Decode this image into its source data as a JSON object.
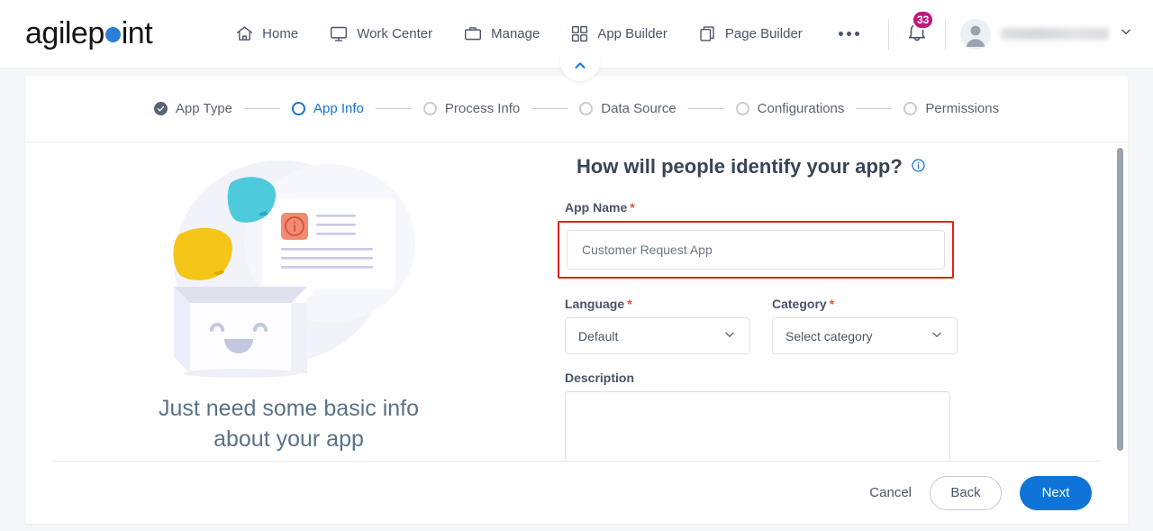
{
  "brand": {
    "name_part1": "agilep",
    "name_part2": "int",
    "dot_color": "#2a7fd4"
  },
  "topnav": {
    "items": [
      {
        "label": "Home",
        "icon": "home-icon"
      },
      {
        "label": "Work Center",
        "icon": "monitor-icon"
      },
      {
        "label": "Manage",
        "icon": "briefcase-icon"
      },
      {
        "label": "App Builder",
        "icon": "grid-icon"
      },
      {
        "label": "Page Builder",
        "icon": "copy-icon"
      }
    ],
    "more_label": "",
    "notifications": {
      "count": "33",
      "icon": "bell-icon",
      "badge_color": "#c2187e"
    },
    "user": {
      "name": "",
      "avatar_icon": "user-avatar-icon",
      "chevron_icon": "chevron-down-icon"
    }
  },
  "collapse": {
    "icon": "chevron-up-icon"
  },
  "stepper": {
    "steps": [
      {
        "label": "App Type",
        "state": "done"
      },
      {
        "label": "App Info",
        "state": "active"
      },
      {
        "label": "Process Info",
        "state": "todo"
      },
      {
        "label": "Data Source",
        "state": "todo"
      },
      {
        "label": "Configurations",
        "state": "todo"
      },
      {
        "label": "Permissions",
        "state": "todo"
      }
    ]
  },
  "illustration": {
    "caption": "Just need some basic info about your app",
    "note_cyan_color": "#4ecadd",
    "note_yellow_color": "#f5c518",
    "info_badge_color": "#f08b72"
  },
  "form": {
    "title": "How will people identify your app?",
    "info_icon": "info-icon",
    "app_name": {
      "label": "App Name",
      "required": "*",
      "value": "Customer Request App",
      "placeholder": "Customer Request App",
      "highlighted": true,
      "highlight_color": "#e2231a"
    },
    "language": {
      "label": "Language",
      "required": "*",
      "value": "Default",
      "chevron_icon": "chevron-down-icon"
    },
    "category": {
      "label": "Category",
      "required": "*",
      "value": "Select category",
      "chevron_icon": "chevron-down-icon"
    },
    "description": {
      "label": "Description",
      "value": "",
      "placeholder": ""
    }
  },
  "footer": {
    "cancel_label": "Cancel",
    "back_label": "Back",
    "next_label": "Next",
    "next_color": "#0f74d8"
  }
}
